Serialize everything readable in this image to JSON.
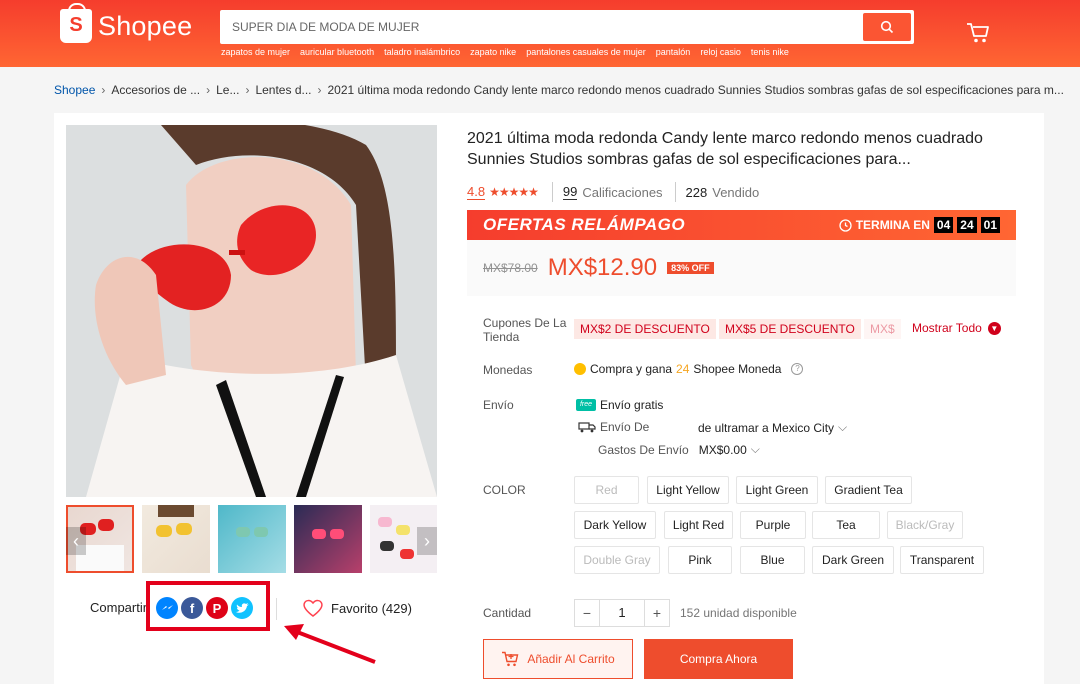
{
  "header": {
    "logo_text": "Shopee",
    "logo_letter": "S",
    "search_placeholder": "SUPER DIA DE MODA DE MUJER",
    "suggestions": [
      "zapatos de mujer",
      "auricular bluetooth",
      "taladro inalámbrico",
      "zapato nike",
      "pantalones casuales de mujer",
      "pantalón",
      "reloj casio",
      "tenis nike"
    ]
  },
  "breadcrumb": [
    "Shopee",
    "Accesorios de ...",
    "Le...",
    "Lentes d...",
    "2021 última moda redondo Candy lente marco redondo menos cuadrado Sunnies Studios sombras gafas de sol especificaciones para m..."
  ],
  "product": {
    "title": "2021 última moda redonda Candy lente marco redondo menos cuadrado Sunnies Studios sombras gafas de sol especificaciones para...",
    "rating": "4.8",
    "stars": "★★★★★",
    "ratings_count": "99",
    "ratings_label": "Calificaciones",
    "sold": "228",
    "sold_label": "Vendido"
  },
  "flash": {
    "title": "OFERTAS RELÁMPAGO",
    "ends_label": "TERMINA EN",
    "hours": "04",
    "minutes": "24",
    "seconds": "01"
  },
  "price": {
    "old": "MX$78.00",
    "new": "MX$12.90",
    "discount": "83% OFF"
  },
  "coupons": {
    "label": "Cupones De La Tienda",
    "items": [
      "MX$2 DE DESCUENTO",
      "MX$5 DE DESCUENTO",
      "MX$"
    ],
    "show_all": "Mostrar Todo"
  },
  "coins": {
    "label": "Monedas",
    "prefix": "Compra y gana",
    "amount": "24",
    "suffix": "Shopee Moneda"
  },
  "shipping": {
    "label": "Envío",
    "free": "Envío gratis",
    "from_label": "Envío De",
    "from_value": "de ultramar a Mexico City",
    "cost_label": "Gastos De Envío",
    "cost_value": "MX$0.00"
  },
  "color": {
    "label": "COLOR",
    "options": [
      "Red",
      "Light Yellow",
      "Light Green",
      "Gradient Tea",
      "Dark Yellow",
      "Light Red",
      "Purple",
      "Tea",
      "Black/Gray",
      "Double Gray",
      "Pink",
      "Blue",
      "Dark Green",
      "Transparent"
    ]
  },
  "quantity": {
    "label": "Cantidad",
    "value": "1",
    "stock": "152 unidad disponible"
  },
  "actions": {
    "add_to_cart": "Añadir Al Carrito",
    "buy_now": "Compra Ahora"
  },
  "share": {
    "label": "Compartir:",
    "favorite": "Favorito (429)"
  },
  "colors": {
    "brand": "#ee4d2d",
    "messenger": "#0084ff",
    "facebook": "#3b5999",
    "pinterest": "#de0217",
    "twitter": "#10c2ff"
  }
}
